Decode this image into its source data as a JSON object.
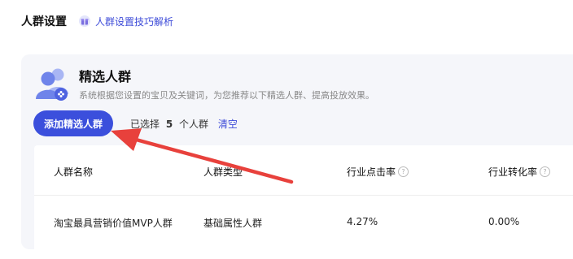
{
  "header": {
    "title": "人群设置",
    "tip_label": "人群设置技巧解析",
    "tip_icon": "gift-icon"
  },
  "section": {
    "title": "精选人群",
    "description": "系统根据您设置的宝贝及关键词，为您推荐以下精选人群、提高投放效果。",
    "icon": "people-group-icon"
  },
  "actions": {
    "add_button": "添加精选人群",
    "selected_prefix": "已选择",
    "selected_count": "5",
    "selected_suffix": "个人群",
    "clear_label": "清空"
  },
  "table": {
    "columns": [
      {
        "label": "人群名称",
        "help": false
      },
      {
        "label": "人群类型",
        "help": false
      },
      {
        "label": "行业点击率",
        "help": true
      },
      {
        "label": "行业转化率",
        "help": true
      }
    ],
    "rows": [
      [
        "淘宝最具营销价值MVP人群",
        "基础属性人群",
        "4.27%",
        "0.00%"
      ]
    ]
  },
  "colors": {
    "accent": "#3b4fdc",
    "link": "#3d4bd8",
    "annotation_arrow": "#e8413c"
  }
}
